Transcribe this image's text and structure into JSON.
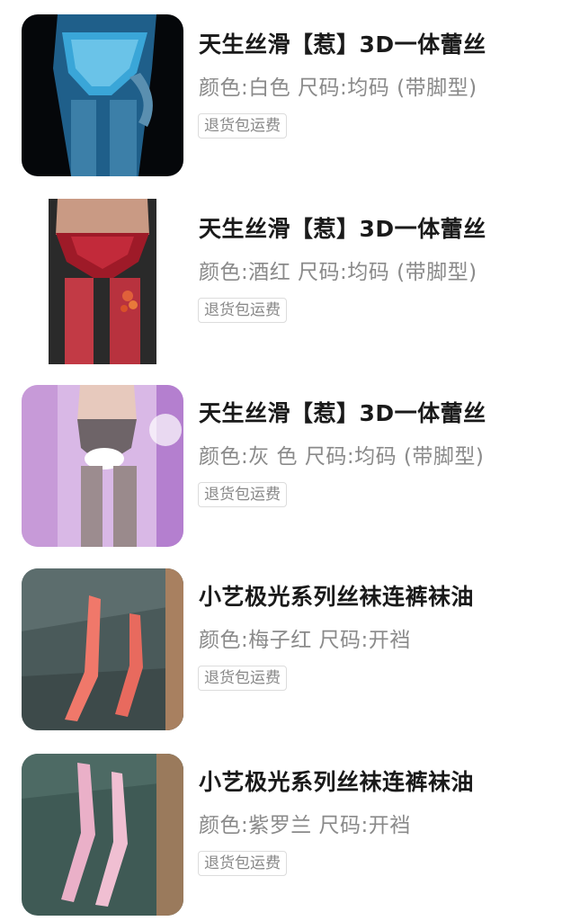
{
  "items": [
    {
      "title": "天生丝滑【惹】3D一体蕾丝",
      "spec": "颜色:白色 尺码:均码 (带脚型)",
      "tag": "退货包运费",
      "image_icon": "product-photo-blue-lace"
    },
    {
      "title": "天生丝滑【惹】3D一体蕾丝",
      "spec": "颜色:酒红 尺码:均码 (带脚型)",
      "tag": "退货包运费",
      "image_icon": "product-photo-wine-red-lace"
    },
    {
      "title": "天生丝滑【惹】3D一体蕾丝",
      "spec": "颜色:灰 色 尺码:均码 (带脚型)",
      "tag": "退货包运费",
      "image_icon": "product-photo-grey-lace"
    },
    {
      "title": "小艺极光系列丝袜连裤袜油",
      "spec": "颜色:梅子红 尺码:开裆",
      "tag": "退货包运费",
      "image_icon": "product-photo-plum-red-tights"
    },
    {
      "title": "小艺极光系列丝袜连裤袜油",
      "spec": "颜色:紫罗兰 尺码:开裆",
      "tag": "退货包运费",
      "image_icon": "product-photo-violet-tights"
    }
  ],
  "colors": {
    "title": "#1a1a1a",
    "spec": "#8a8a8a",
    "tag_text": "#888888",
    "tag_border": "#dcdcdc"
  }
}
